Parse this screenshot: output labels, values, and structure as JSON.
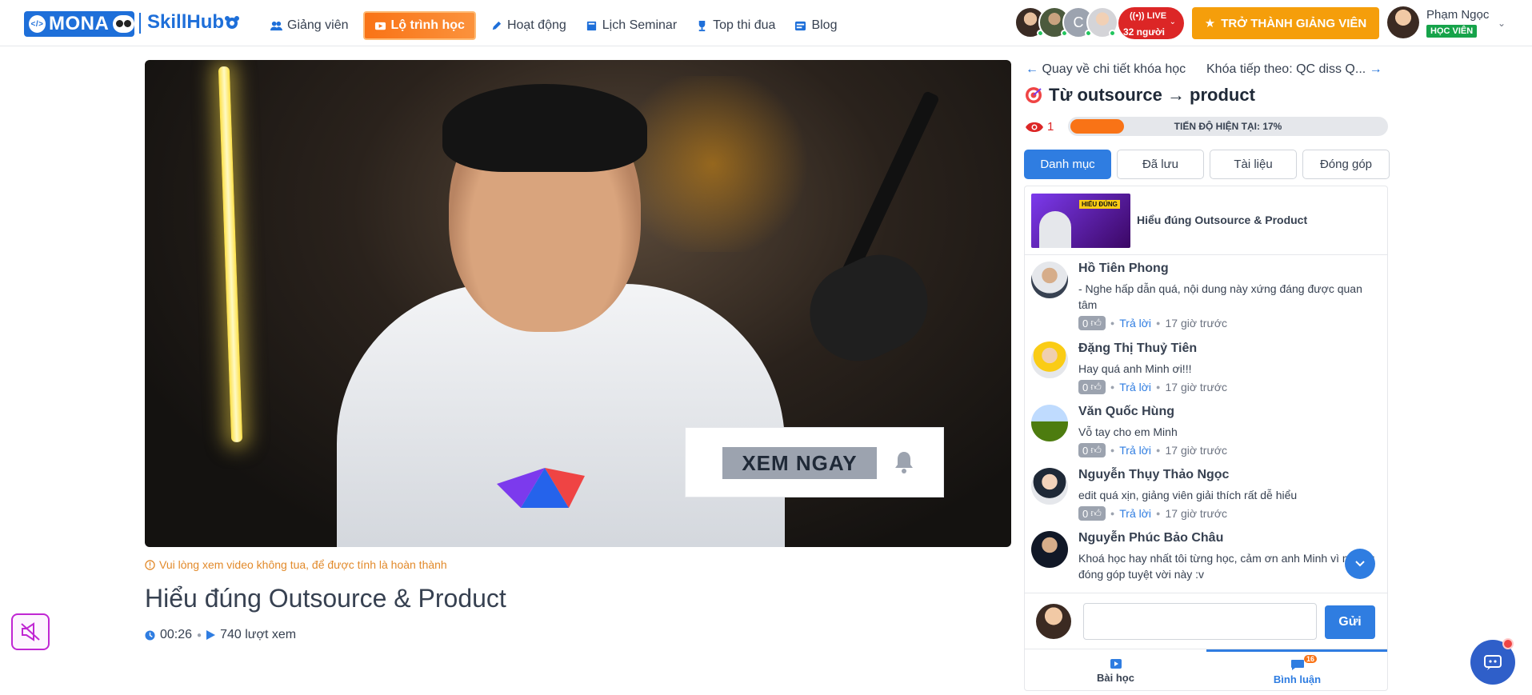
{
  "brand": {
    "mona": "MONA",
    "skillhub": "SkillHub"
  },
  "nav": [
    {
      "label": "Giảng viên",
      "icon": "users-icon"
    },
    {
      "label": "Lộ trình học",
      "icon": "video-icon",
      "highlight": true
    },
    {
      "label": "Hoạt động",
      "icon": "pen-icon"
    },
    {
      "label": "Lịch Seminar",
      "icon": "book-icon"
    },
    {
      "label": "Top thi đua",
      "icon": "trophy-icon"
    },
    {
      "label": "Blog",
      "icon": "blog-icon"
    }
  ],
  "live": {
    "label": "LIVE",
    "count": "32 người"
  },
  "cta": {
    "label": "TRỞ THÀNH GIẢNG VIÊN"
  },
  "user": {
    "name": "Phạm Ngọc",
    "role": "HỌC VIÊN"
  },
  "video": {
    "overlay_button": "XEM NGAY"
  },
  "note": "Vui lòng xem video không tua, để được tính là hoàn thành",
  "lesson": {
    "title": "Hiểu đúng Outsource & Product",
    "duration": "00:26",
    "views": "740 lượt xem"
  },
  "sidebar": {
    "back": "Quay về chi tiết khóa học",
    "next": "Khóa tiếp theo: QC diss Q...",
    "course_title": "Từ outsource → product",
    "view_count": "1",
    "progress_label": "TIẾN ĐỘ HIỆN TẠI: 17%",
    "progress_value": 0.17,
    "tabs": [
      "Danh mục",
      "Đã lưu",
      "Tài liệu",
      "Đóng góp"
    ],
    "current_lesson": {
      "name": "Hiểu đúng Outsource & Product",
      "thumb_tag": "HIỂU ĐÚNG"
    },
    "comments": [
      {
        "name": "Hồ Tiên Phong",
        "text": "- Nghe hấp dẫn quá, nội dung này xứng đáng được quan tâm",
        "likes": "0",
        "reply": "Trả lời",
        "time": "17 giờ trước"
      },
      {
        "name": "Đặng Thị Thuỷ Tiên",
        "text": "Hay quá anh Minh ơi!!!",
        "likes": "0",
        "reply": "Trả lời",
        "time": "17 giờ trước"
      },
      {
        "name": "Văn Quốc Hùng",
        "text": "Vỗ tay cho em Minh",
        "likes": "0",
        "reply": "Trả lời",
        "time": "17 giờ trước"
      },
      {
        "name": "Nguyễn Thụy Thảo Ngọc",
        "text": "edit quá xịn, giảng viên giải thích rất dễ hiểu",
        "likes": "0",
        "reply": "Trả lời",
        "time": "17 giờ trước"
      },
      {
        "name": "Nguyễn Phúc Bảo Châu",
        "text": "Khoá học hay nhất tôi từng học, cảm ơn anh Minh vì những đóng góp tuyệt vời này :v",
        "likes": "0",
        "reply": "Trả lời",
        "time": "17 giờ trước"
      }
    ],
    "send_label": "Gửi",
    "reply_placeholder": "",
    "bottom_tabs": [
      {
        "label": "Bài học",
        "icon": "video-icon"
      },
      {
        "label": "Bình luận",
        "icon": "chat-icon",
        "badge": "16"
      }
    ]
  },
  "colors": {
    "primary": "#2f7de1",
    "accent": "#f59e0b",
    "live": "#dc2626",
    "progress": "#f97316"
  }
}
